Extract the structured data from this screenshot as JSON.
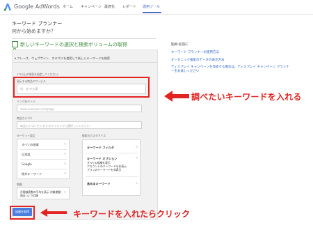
{
  "header": {
    "brand": "Google AdWords",
    "nav": [
      "ホーム",
      "キャンペーン",
      "最適化",
      "レポート",
      "運用ツール"
    ],
    "active_nav": "運用ツール"
  },
  "page": {
    "title": "キーワード プランナー",
    "subtitle": "何から始めますか？",
    "section_title": "新しいキーワードの選択と検索ボリュームの取得",
    "collapse_row": "フレーズ、ウェブサイト、カテゴリを使用して新しいキーワードを検索"
  },
  "form": {
    "instruction": "1つ以上の項目を指定してください:",
    "product_label": "宣伝する商品やサービス",
    "product_placeholder": "例：花 中古車",
    "landing_label": "リンク先ページ",
    "landing_placeholder": "www.example.com/page",
    "category_label": "商品カテゴリ",
    "category_placeholder": "商品カテゴリを入力するかリストから選択してください",
    "targeting_label": "ターゲット設定",
    "targeting_items": [
      "すべての地域",
      "日本語",
      "Google",
      "除外キーワード"
    ],
    "period_label": "期間",
    "period_text": "月間検索数の平均を表示 対象期間：過去 12 か月間",
    "custom_label": "検索のカスタマイズ",
    "custom_items": [
      {
        "title": "キーワード フィルタ",
        "detail": ""
      },
      {
        "title": "キーワード オプション",
        "detail": "すべての候補を表示\nアカウントのキーワードを非表示\nプランのキーワードを非表示"
      },
      {
        "title": "含めるキーワード",
        "detail": ""
      }
    ],
    "submit_label": "候補を取得"
  },
  "help": {
    "title": "始める前に",
    "links": [
      "キーワード プランナーの使用方法",
      "オーガニック検索のデータの表示方法",
      "ディスプレイ キャンペーンを作成する場合は、ディスプレイ キャンペーン プランナーをお試しください"
    ]
  },
  "annotations": {
    "callout1": "調べたいキーワードを入れる",
    "callout2": "キーワードを入れたらクリック"
  },
  "colors": {
    "accent": "#4a6ec0",
    "green": "#3c8b3c",
    "annotation": "#e32222",
    "button": "#4a7fe0"
  }
}
